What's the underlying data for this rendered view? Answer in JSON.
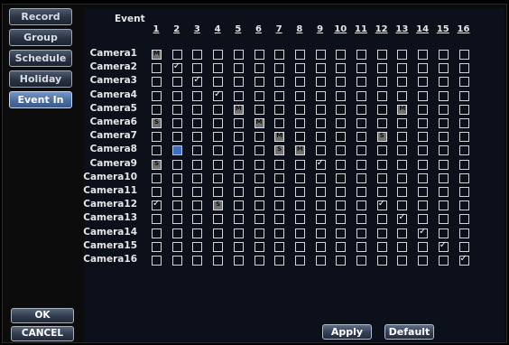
{
  "sidebar": {
    "items": [
      {
        "label": "Record",
        "active": false
      },
      {
        "label": "Group",
        "active": false
      },
      {
        "label": "Schedule",
        "active": false
      },
      {
        "label": "Holiday",
        "active": false
      },
      {
        "label": "Event In",
        "active": true
      }
    ]
  },
  "grid": {
    "title": "Event",
    "columns": [
      "1",
      "2",
      "3",
      "4",
      "5",
      "6",
      "7",
      "8",
      "9",
      "10",
      "11",
      "12",
      "13",
      "14",
      "15",
      "16"
    ],
    "rows": [
      "Camera1",
      "Camera2",
      "Camera3",
      "Camera4",
      "Camera5",
      "Camera6",
      "Camera7",
      "Camera8",
      "Camera9",
      "Camera10",
      "Camera11",
      "Camera12",
      "Camera13",
      "Camera14",
      "Camera15",
      "Camera16"
    ],
    "cell_states": [
      "M...............",
      ".v..............",
      "..v.............",
      "...v............",
      "....M.......M...",
      "S....M..........",
      "......M....S....",
      ".F....SM........",
      "S.......v.......",
      "................",
      "................",
      "v..S.......v....",
      "............v...",
      ".............v..",
      "..............v.",
      "...............v"
    ],
    "legend": {
      "v": "checked",
      "M": "motion",
      "S": "sensor",
      "F": "focused"
    }
  },
  "footer": {
    "ok_label": "OK",
    "cancel_label": "CANCEL",
    "apply_label": "Apply",
    "default_label": "Default"
  }
}
